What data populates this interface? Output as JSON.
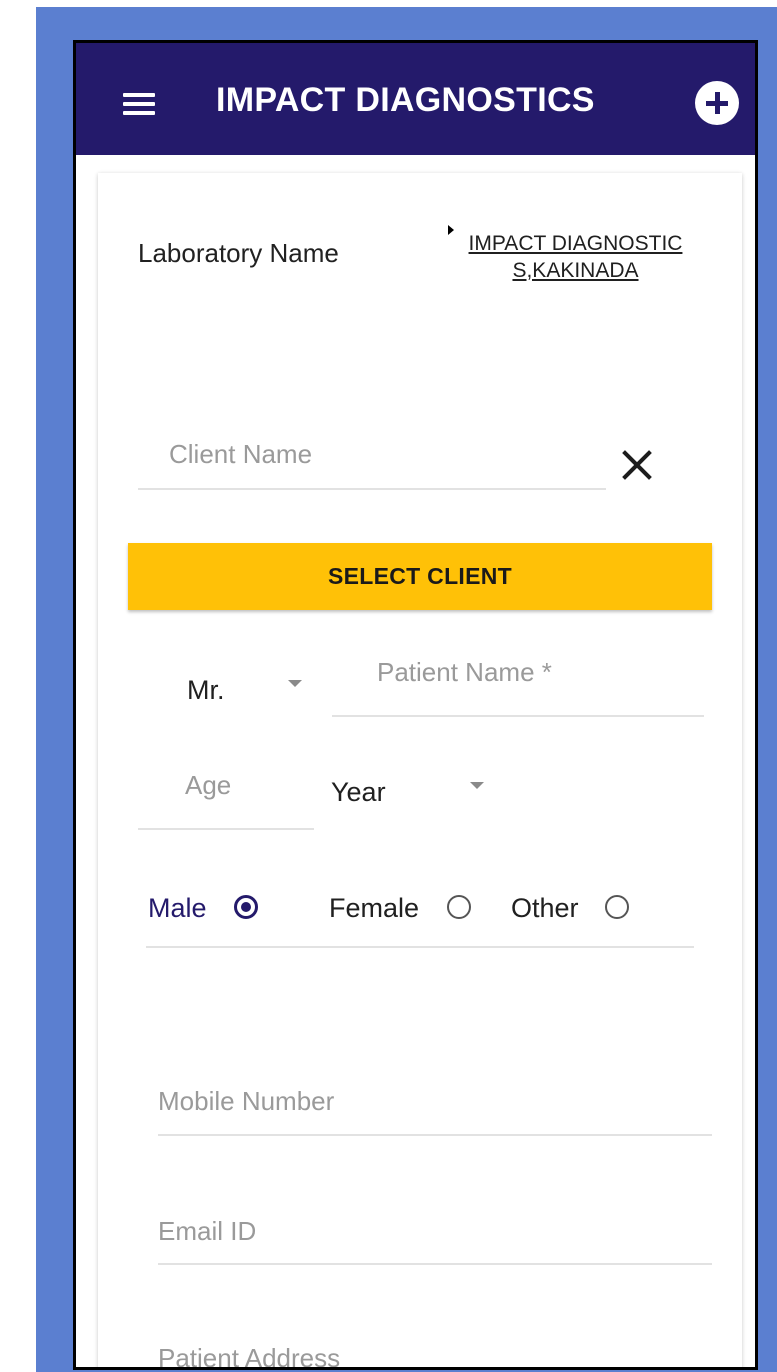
{
  "app_bar": {
    "title": "IMPACT DIAGNOSTICS",
    "background_color": "#241a6b",
    "menu_icon": "hamburger-menu-icon",
    "add_icon": "add-circle-icon"
  },
  "form": {
    "laboratory": {
      "label": "Laboratory Name",
      "value": "IMPACT DIAGNOSTICS,KAKINADA"
    },
    "client_name": {
      "placeholder": "Client Name",
      "value": ""
    },
    "select_client_button": "SELECT CLIENT",
    "title_select": {
      "value": "Mr."
    },
    "patient_name": {
      "placeholder": "Patient Name *",
      "value": ""
    },
    "age": {
      "placeholder": "Age",
      "value": ""
    },
    "age_unit": {
      "value": "Year"
    },
    "gender": {
      "options": [
        {
          "label": "Male",
          "selected": true
        },
        {
          "label": "Female",
          "selected": false
        },
        {
          "label": "Other",
          "selected": false
        }
      ]
    },
    "mobile_number": {
      "placeholder": "Mobile Number",
      "value": ""
    },
    "email_id": {
      "placeholder": "Email ID",
      "value": ""
    },
    "patient_address": {
      "placeholder": "Patient Address",
      "value": ""
    }
  },
  "colors": {
    "accent": "#241a6b",
    "button": "#ffc107",
    "frame": "#5b7fd0"
  }
}
